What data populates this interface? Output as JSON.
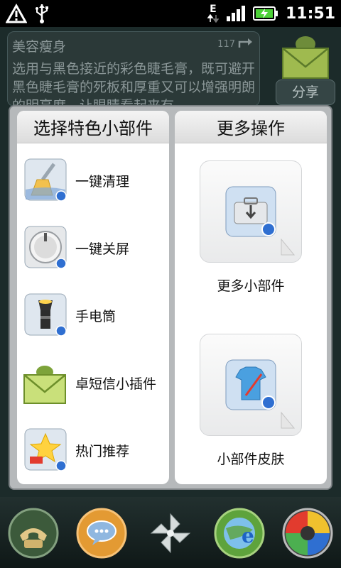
{
  "status_bar": {
    "network": "E",
    "time": "11:51",
    "colors": {
      "battery": "#4cd137"
    }
  },
  "background_widget": {
    "title": "美容瘦身",
    "count": "117",
    "text": "选用与黑色接近的彩色睫毛膏，既可避开黑色睫毛膏的死板和厚重又可以增强明朗的明亮度，让眼睛看起来有",
    "share_label": "分享"
  },
  "left_column": {
    "title": "选择特色小部件",
    "items": [
      {
        "label": "一键清理",
        "icon": "broom-icon"
      },
      {
        "label": "一键关屏",
        "icon": "power-knob-icon"
      },
      {
        "label": "手电筒",
        "icon": "flashlight-icon"
      },
      {
        "label": "卓短信小插件",
        "icon": "android-sms-envelope-icon"
      },
      {
        "label": "热门推荐",
        "icon": "hot-star-icon"
      }
    ]
  },
  "right_column": {
    "title": "更多操作",
    "tiles": [
      {
        "label": "更多小部件",
        "icon": "toolbox-download-icon"
      },
      {
        "label": "小部件皮肤",
        "icon": "tshirt-paint-icon"
      }
    ]
  },
  "dock": {
    "items": [
      {
        "name": "phone",
        "icon": "phone-icon"
      },
      {
        "name": "messages",
        "icon": "message-bubble-icon"
      },
      {
        "name": "app-drawer",
        "icon": "pinwheel-icon"
      },
      {
        "name": "browser",
        "icon": "globe-e-icon"
      },
      {
        "name": "multi-color",
        "icon": "color-wheel-icon"
      }
    ]
  }
}
